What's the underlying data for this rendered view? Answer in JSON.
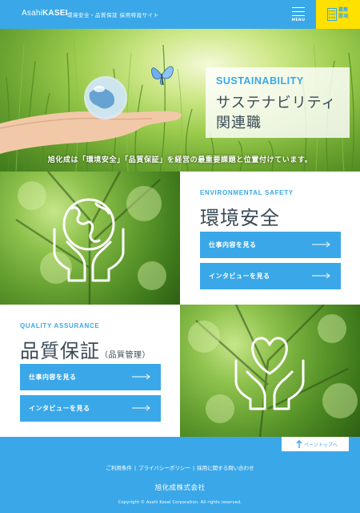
{
  "header": {
    "logo_prefix": "Asahi",
    "logo_main": "KASEI",
    "site_title": "環境安全・品質保証 採用特設サイト",
    "menu_label": "MENU",
    "recruit_label": "募集要項"
  },
  "hero": {
    "heading_en": "SUSTAINABILITY",
    "heading_jp_line1": "サステナビリティ",
    "heading_jp_line2": "関連職",
    "caption": "旭化成は「環境安全」「品質保証」を経営の最重要課題と位置付けています。"
  },
  "env": {
    "heading_en": "ENVIRONMENTAL SAFETY",
    "heading_jp": "環境安全",
    "btn_work": "仕事内容を見る",
    "btn_interview": "インタビューを見る"
  },
  "qa": {
    "heading_en": "QUALITY ASSURANCE",
    "heading_jp": "品質保証",
    "heading_sub": "（品質管理）",
    "btn_work": "仕事内容を見る",
    "btn_interview": "インタビューを見る"
  },
  "footer": {
    "page_top": "ページトップへ",
    "links": [
      "ご利用条件",
      "プライバシーポリシー",
      "採用に関する問い合わせ"
    ],
    "separator": "|",
    "company": "旭化成株式会社",
    "copyright": "Copyright © Asahi Kasei Corporation. All rights reserved."
  },
  "colors": {
    "accent": "#3aa8e8",
    "recruit": "#ffe100",
    "heading_text": "#3a4a55"
  },
  "icons": [
    "menu-icon",
    "list-icon",
    "butterfly-icon",
    "globe-icon",
    "hands-globe-icon",
    "hands-heart-icon",
    "arrow-right-icon",
    "arrow-up-icon"
  ]
}
